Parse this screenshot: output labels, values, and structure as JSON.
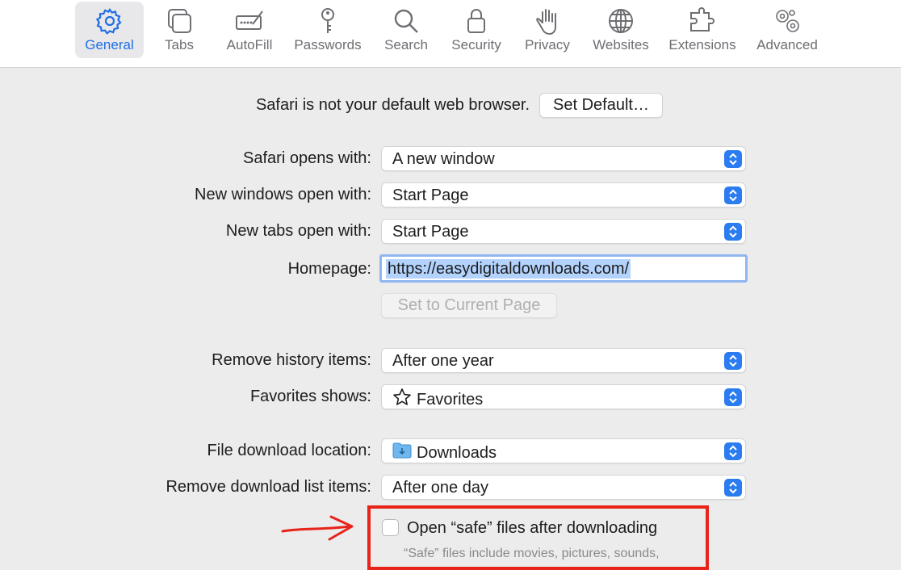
{
  "toolbar": {
    "tabs": [
      {
        "label": "General",
        "icon": "gear-icon",
        "active": true
      },
      {
        "label": "Tabs",
        "icon": "tabs-icon"
      },
      {
        "label": "AutoFill",
        "icon": "autofill-icon"
      },
      {
        "label": "Passwords",
        "icon": "key-icon"
      },
      {
        "label": "Search",
        "icon": "magnifier-icon"
      },
      {
        "label": "Security",
        "icon": "lock-icon"
      },
      {
        "label": "Privacy",
        "icon": "hand-icon"
      },
      {
        "label": "Websites",
        "icon": "globe-icon"
      },
      {
        "label": "Extensions",
        "icon": "puzzle-icon"
      },
      {
        "label": "Advanced",
        "icon": "gears-icon"
      }
    ]
  },
  "default_browser": {
    "message": "Safari is not your default web browser.",
    "button": "Set Default…"
  },
  "settings": {
    "opens_with": {
      "label": "Safari opens with:",
      "value": "A new window"
    },
    "new_windows": {
      "label": "New windows open with:",
      "value": "Start Page"
    },
    "new_tabs": {
      "label": "New tabs open with:",
      "value": "Start Page"
    },
    "homepage": {
      "label": "Homepage:",
      "value": "https://easydigitaldownloads.com/"
    },
    "set_current": "Set to Current Page",
    "remove_history": {
      "label": "Remove history items:",
      "value": "After one year"
    },
    "favorites_shows": {
      "label": "Favorites shows:",
      "value": "Favorites"
    },
    "download_location": {
      "label": "File download location:",
      "value": "Downloads"
    },
    "remove_downloads": {
      "label": "Remove download list items:",
      "value": "After one day"
    },
    "open_safe": {
      "label": "Open “safe” files after downloading",
      "checked": false
    },
    "open_safe_help": "“Safe” files include movies, pictures, sounds,"
  },
  "colors": {
    "accent": "#1f6fe5",
    "annotation": "#e8231a"
  }
}
